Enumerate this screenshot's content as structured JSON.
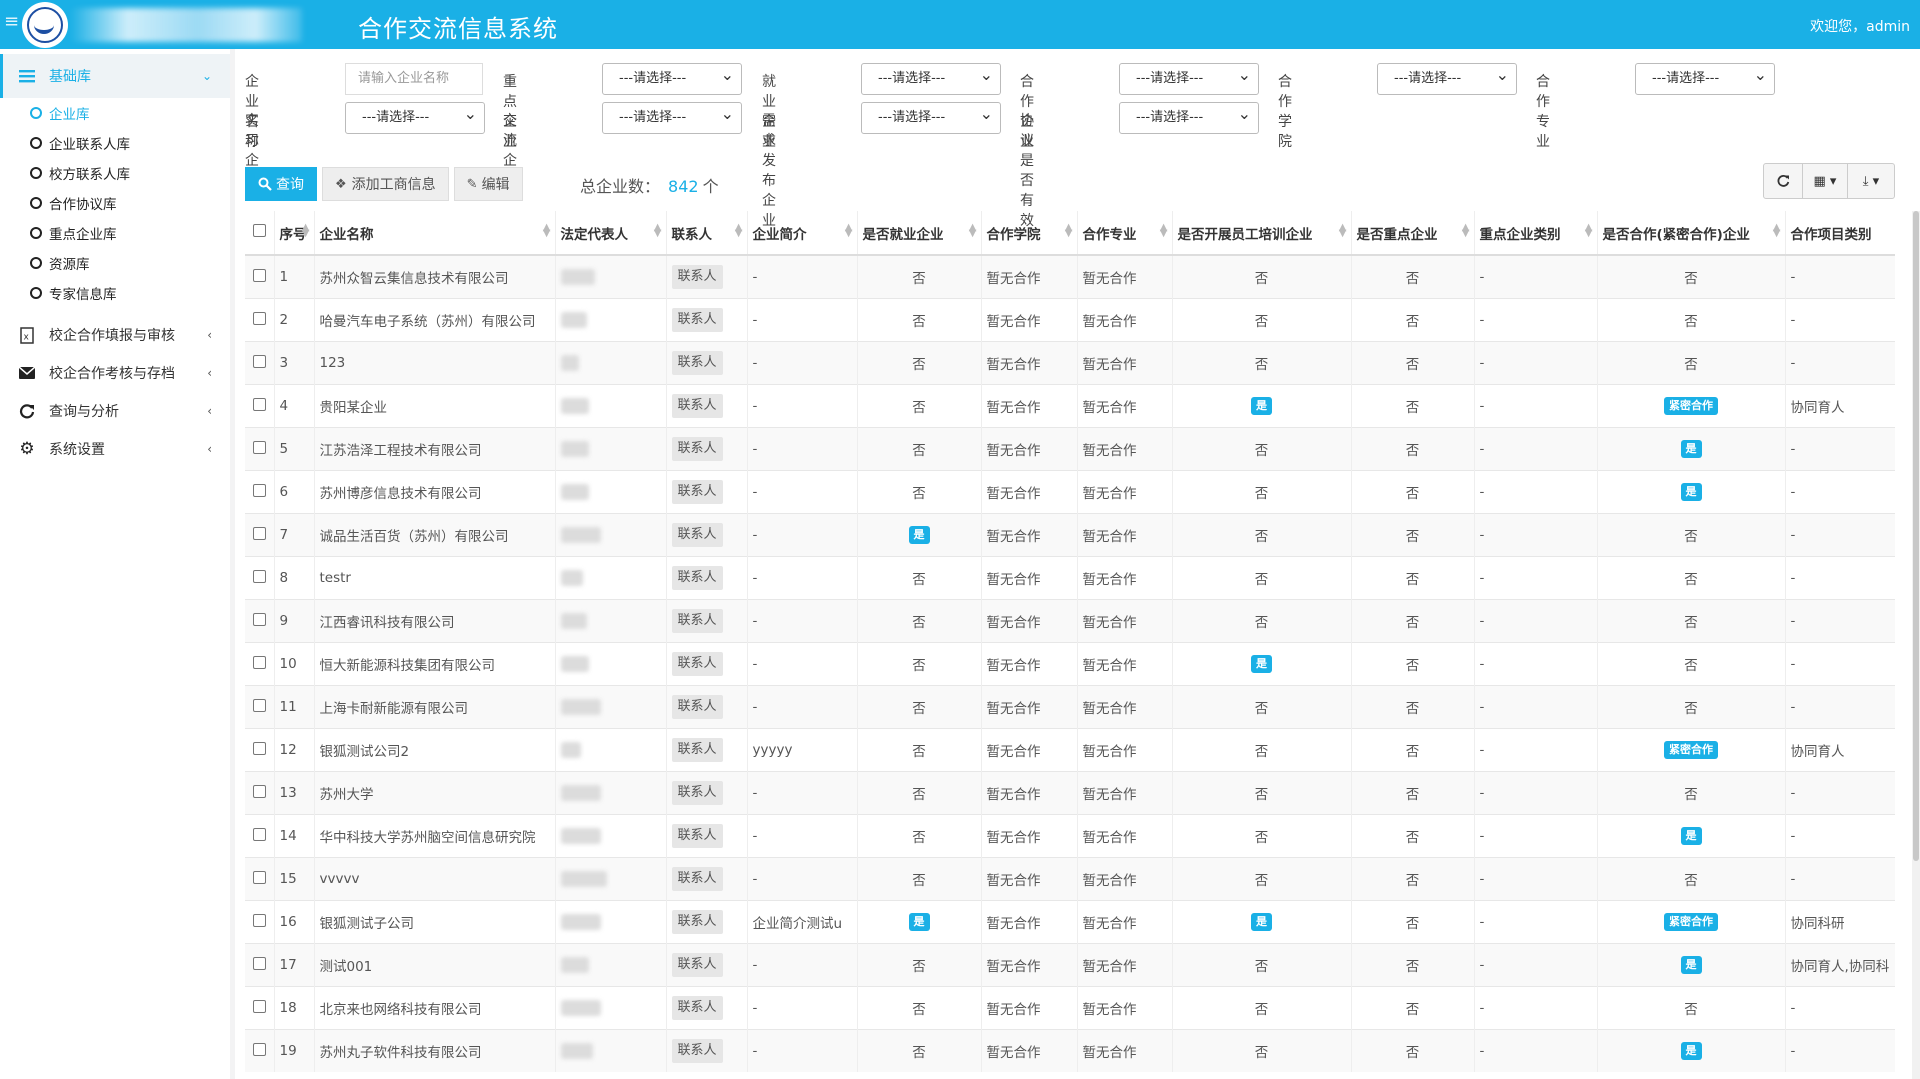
{
  "header": {
    "title": "合作交流信息系统",
    "welcome": "欢迎您，admin",
    "menu_icon": "hamburger-icon"
  },
  "sidebar": {
    "groups": [
      {
        "label": "基础库",
        "icon": "list-icon",
        "expanded": true
      },
      {
        "label": "校企合作填报与审核",
        "icon": "excel-file-icon"
      },
      {
        "label": "校企合作考核与存档",
        "icon": "envelope-icon"
      },
      {
        "label": "查询与分析",
        "icon": "refresh-icon"
      },
      {
        "label": "系统设置",
        "icon": "gear-icon"
      }
    ],
    "sub_items": [
      "企业库",
      "企业联系人库",
      "校方联系人库",
      "合作协议库",
      "重点企业库",
      "资源库",
      "专家信息库"
    ]
  },
  "filters": {
    "company_name_label": "企业名称",
    "company_name_placeholder": "请输入企业名称",
    "select_placeholder": "---请选择---",
    "labels": [
      "重点企业",
      "就业企业",
      "合作企业",
      "合作学院",
      "合作专业",
      "实习企业",
      "交流企业",
      "需求发布企业",
      "协议是否有效"
    ]
  },
  "toolbar": {
    "query": "查询",
    "add": "添加工商信息",
    "edit": "编辑",
    "total_label": "总企业数：",
    "total_count": "842",
    "total_unit": "个"
  },
  "table": {
    "columns": [
      "序号",
      "企业名称",
      "法定代表人",
      "联系人",
      "企业简介",
      "是否就业企业",
      "合作学院",
      "合作专业",
      "是否开展员工培训企业",
      "是否重点企业",
      "重点企业类别",
      "是否合作(紧密合作)企业",
      "合作项目类别"
    ],
    "contact_label": "联系人",
    "rows": [
      {
        "no": "1",
        "name": "苏州众智云集信息技术有限公司",
        "intro": "-",
        "employ": "否",
        "college": "暂无合作",
        "major": "暂无合作",
        "train": "否",
        "key": "否",
        "keytype": "-",
        "coop": "否",
        "proj": "-"
      },
      {
        "no": "2",
        "name": "哈曼汽车电子系统（苏州）有限公司",
        "intro": "-",
        "employ": "否",
        "college": "暂无合作",
        "major": "暂无合作",
        "train": "否",
        "key": "否",
        "keytype": "-",
        "coop": "否",
        "proj": "-"
      },
      {
        "no": "3",
        "name": "123",
        "intro": "-",
        "employ": "否",
        "college": "暂无合作",
        "major": "暂无合作",
        "train": "否",
        "key": "否",
        "keytype": "-",
        "coop": "否",
        "proj": "-"
      },
      {
        "no": "4",
        "name": "贵阳某企业",
        "intro": "-",
        "employ": "否",
        "college": "暂无合作",
        "major": "暂无合作",
        "train": "是",
        "key": "否",
        "keytype": "-",
        "coop": "紧密合作",
        "proj": "协同育人"
      },
      {
        "no": "5",
        "name": "江苏浩泽工程技术有限公司",
        "intro": "-",
        "employ": "否",
        "college": "暂无合作",
        "major": "暂无合作",
        "train": "否",
        "key": "否",
        "keytype": "-",
        "coop": "是",
        "proj": "-"
      },
      {
        "no": "6",
        "name": "苏州博彦信息技术有限公司",
        "intro": "-",
        "employ": "否",
        "college": "暂无合作",
        "major": "暂无合作",
        "train": "否",
        "key": "否",
        "keytype": "-",
        "coop": "是",
        "proj": "-"
      },
      {
        "no": "7",
        "name": "诚品生活百货（苏州）有限公司",
        "intro": "-",
        "employ": "是",
        "college": "暂无合作",
        "major": "暂无合作",
        "train": "否",
        "key": "否",
        "keytype": "-",
        "coop": "否",
        "proj": "-"
      },
      {
        "no": "8",
        "name": "testr",
        "intro": "-",
        "employ": "否",
        "college": "暂无合作",
        "major": "暂无合作",
        "train": "否",
        "key": "否",
        "keytype": "-",
        "coop": "否",
        "proj": "-"
      },
      {
        "no": "9",
        "name": "江西睿讯科技有限公司",
        "intro": "-",
        "employ": "否",
        "college": "暂无合作",
        "major": "暂无合作",
        "train": "否",
        "key": "否",
        "keytype": "-",
        "coop": "否",
        "proj": "-"
      },
      {
        "no": "10",
        "name": "恒大新能源科技集团有限公司",
        "intro": "-",
        "employ": "否",
        "college": "暂无合作",
        "major": "暂无合作",
        "train": "是",
        "key": "否",
        "keytype": "-",
        "coop": "否",
        "proj": "-"
      },
      {
        "no": "11",
        "name": "上海卡耐新能源有限公司",
        "intro": "-",
        "employ": "否",
        "college": "暂无合作",
        "major": "暂无合作",
        "train": "否",
        "key": "否",
        "keytype": "-",
        "coop": "否",
        "proj": "-"
      },
      {
        "no": "12",
        "name": "银狐测试公司2",
        "intro": "yyyyy",
        "employ": "否",
        "college": "暂无合作",
        "major": "暂无合作",
        "train": "否",
        "key": "否",
        "keytype": "-",
        "coop": "紧密合作",
        "proj": "协同育人"
      },
      {
        "no": "13",
        "name": "苏州大学",
        "intro": "-",
        "employ": "否",
        "college": "暂无合作",
        "major": "暂无合作",
        "train": "否",
        "key": "否",
        "keytype": "-",
        "coop": "否",
        "proj": "-"
      },
      {
        "no": "14",
        "name": "华中科技大学苏州脑空间信息研究院",
        "intro": "-",
        "employ": "否",
        "college": "暂无合作",
        "major": "暂无合作",
        "train": "否",
        "key": "否",
        "keytype": "-",
        "coop": "是",
        "proj": "-"
      },
      {
        "no": "15",
        "name": "vvvvv",
        "intro": "-",
        "employ": "否",
        "college": "暂无合作",
        "major": "暂无合作",
        "train": "否",
        "key": "否",
        "keytype": "-",
        "coop": "否",
        "proj": "-"
      },
      {
        "no": "16",
        "name": "银狐测试子公司",
        "intro": "企业简介测试u",
        "employ": "是",
        "college": "暂无合作",
        "major": "暂无合作",
        "train": "是",
        "key": "否",
        "keytype": "-",
        "coop": "紧密合作",
        "proj": "协同科研"
      },
      {
        "no": "17",
        "name": "测试001",
        "intro": "-",
        "employ": "否",
        "college": "暂无合作",
        "major": "暂无合作",
        "train": "否",
        "key": "否",
        "keytype": "-",
        "coop": "是",
        "proj": "协同育人,协同科"
      },
      {
        "no": "18",
        "name": "北京来也网络科技有限公司",
        "intro": "-",
        "employ": "否",
        "college": "暂无合作",
        "major": "暂无合作",
        "train": "否",
        "key": "否",
        "keytype": "-",
        "coop": "否",
        "proj": "-"
      },
      {
        "no": "19",
        "name": "苏州丸子软件科技有限公司",
        "intro": "-",
        "employ": "否",
        "college": "暂无合作",
        "major": "暂无合作",
        "train": "否",
        "key": "否",
        "keytype": "-",
        "coop": "是",
        "proj": "-"
      }
    ]
  },
  "colors": {
    "accent": "#1ab0e6",
    "badge": "#1ab0e6"
  }
}
